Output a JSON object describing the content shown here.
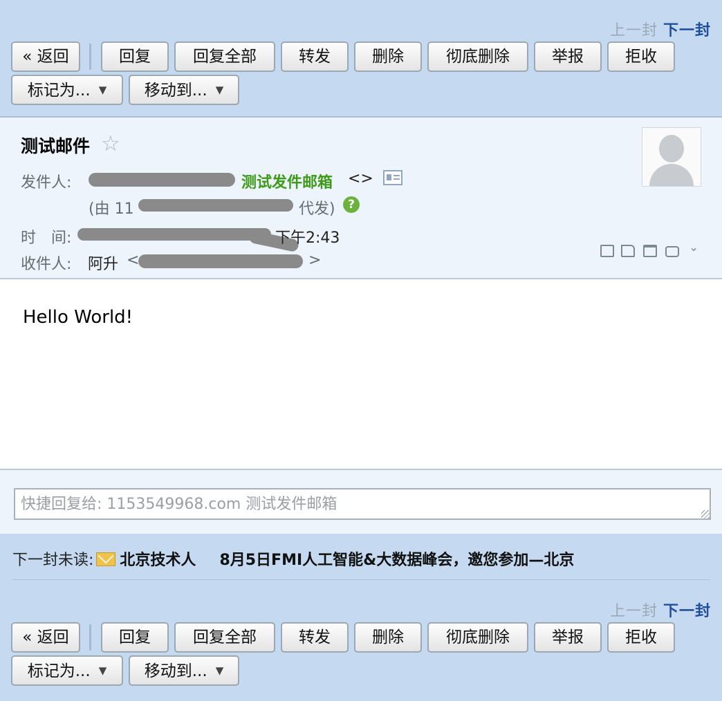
{
  "pager": {
    "prev": "上一封",
    "next": "下一封"
  },
  "toolbar": {
    "back": "« 返回",
    "reply": "回复",
    "reply_all": "回复全部",
    "forward": "转发",
    "delete": "删除",
    "delete_permanently": "彻底删除",
    "report": "举报",
    "reject": "拒收",
    "mark_as": "标记为...",
    "move_to": "移动到..."
  },
  "header": {
    "subject": "测试邮件",
    "from_label": "发件人:",
    "sender_name": "测试发件邮箱",
    "sender_address_brackets": "<>",
    "via_prefix": "(由 11",
    "via_suffix": "代发)",
    "time_label": "时　间:",
    "time_value": "下午2:43",
    "to_label": "收件人:",
    "recipient_name": "阿升",
    "recipient_open": "<",
    "recipient_close": ">"
  },
  "body": {
    "text": "Hello World!"
  },
  "quick_reply": {
    "placeholder": "快捷回复给: 1153549968.com 测试发件邮箱"
  },
  "next_unread": {
    "label": "下一封未读:",
    "sender": "北京技术人",
    "subject": "8月5日FMI人工智能&大数据峰会，邀您参加—北京"
  },
  "colors": {
    "toolbar_bg": "#c5daf1",
    "header_bg": "#eef4fb",
    "sender_green": "#3e9b1a",
    "next_link": "#1f4f9c"
  }
}
